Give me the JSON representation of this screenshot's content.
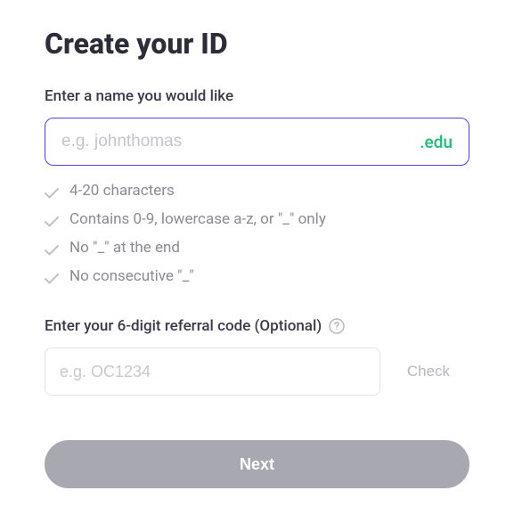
{
  "title": "Create your ID",
  "name_field": {
    "label": "Enter a name you would like",
    "placeholder": "e.g. johnthomas",
    "suffix": ".edu"
  },
  "rules": [
    "4-20 characters",
    "Contains 0-9, lowercase a-z, or \"_\" only",
    "No \"_\" at the end",
    "No consecutive \"_\""
  ],
  "referral_field": {
    "label": "Enter your 6-digit referral code (Optional)",
    "placeholder": "e.g. OC1234",
    "check_label": "Check"
  },
  "next_label": "Next"
}
